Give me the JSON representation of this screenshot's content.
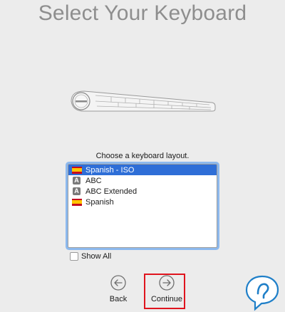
{
  "header": {
    "title": "Select Your Keyboard"
  },
  "prompt": "Choose a keyboard layout.",
  "layouts": [
    {
      "label": "Spanish - ISO",
      "icon": "spain-flag-icon",
      "selected": true
    },
    {
      "label": "ABC",
      "icon": "letter-a-icon",
      "selected": false
    },
    {
      "label": "ABC Extended",
      "icon": "letter-a-icon",
      "selected": false
    },
    {
      "label": "Spanish",
      "icon": "spain-flag-icon",
      "selected": false
    }
  ],
  "abc_icon_glyph": "A",
  "show_all": {
    "label": "Show All",
    "checked": false
  },
  "nav": {
    "back_label": "Back",
    "continue_label": "Continue"
  },
  "colors": {
    "selection": "#2e6ed7",
    "highlight_box": "#e0141e",
    "logo_blue": "#1f7fc8"
  }
}
